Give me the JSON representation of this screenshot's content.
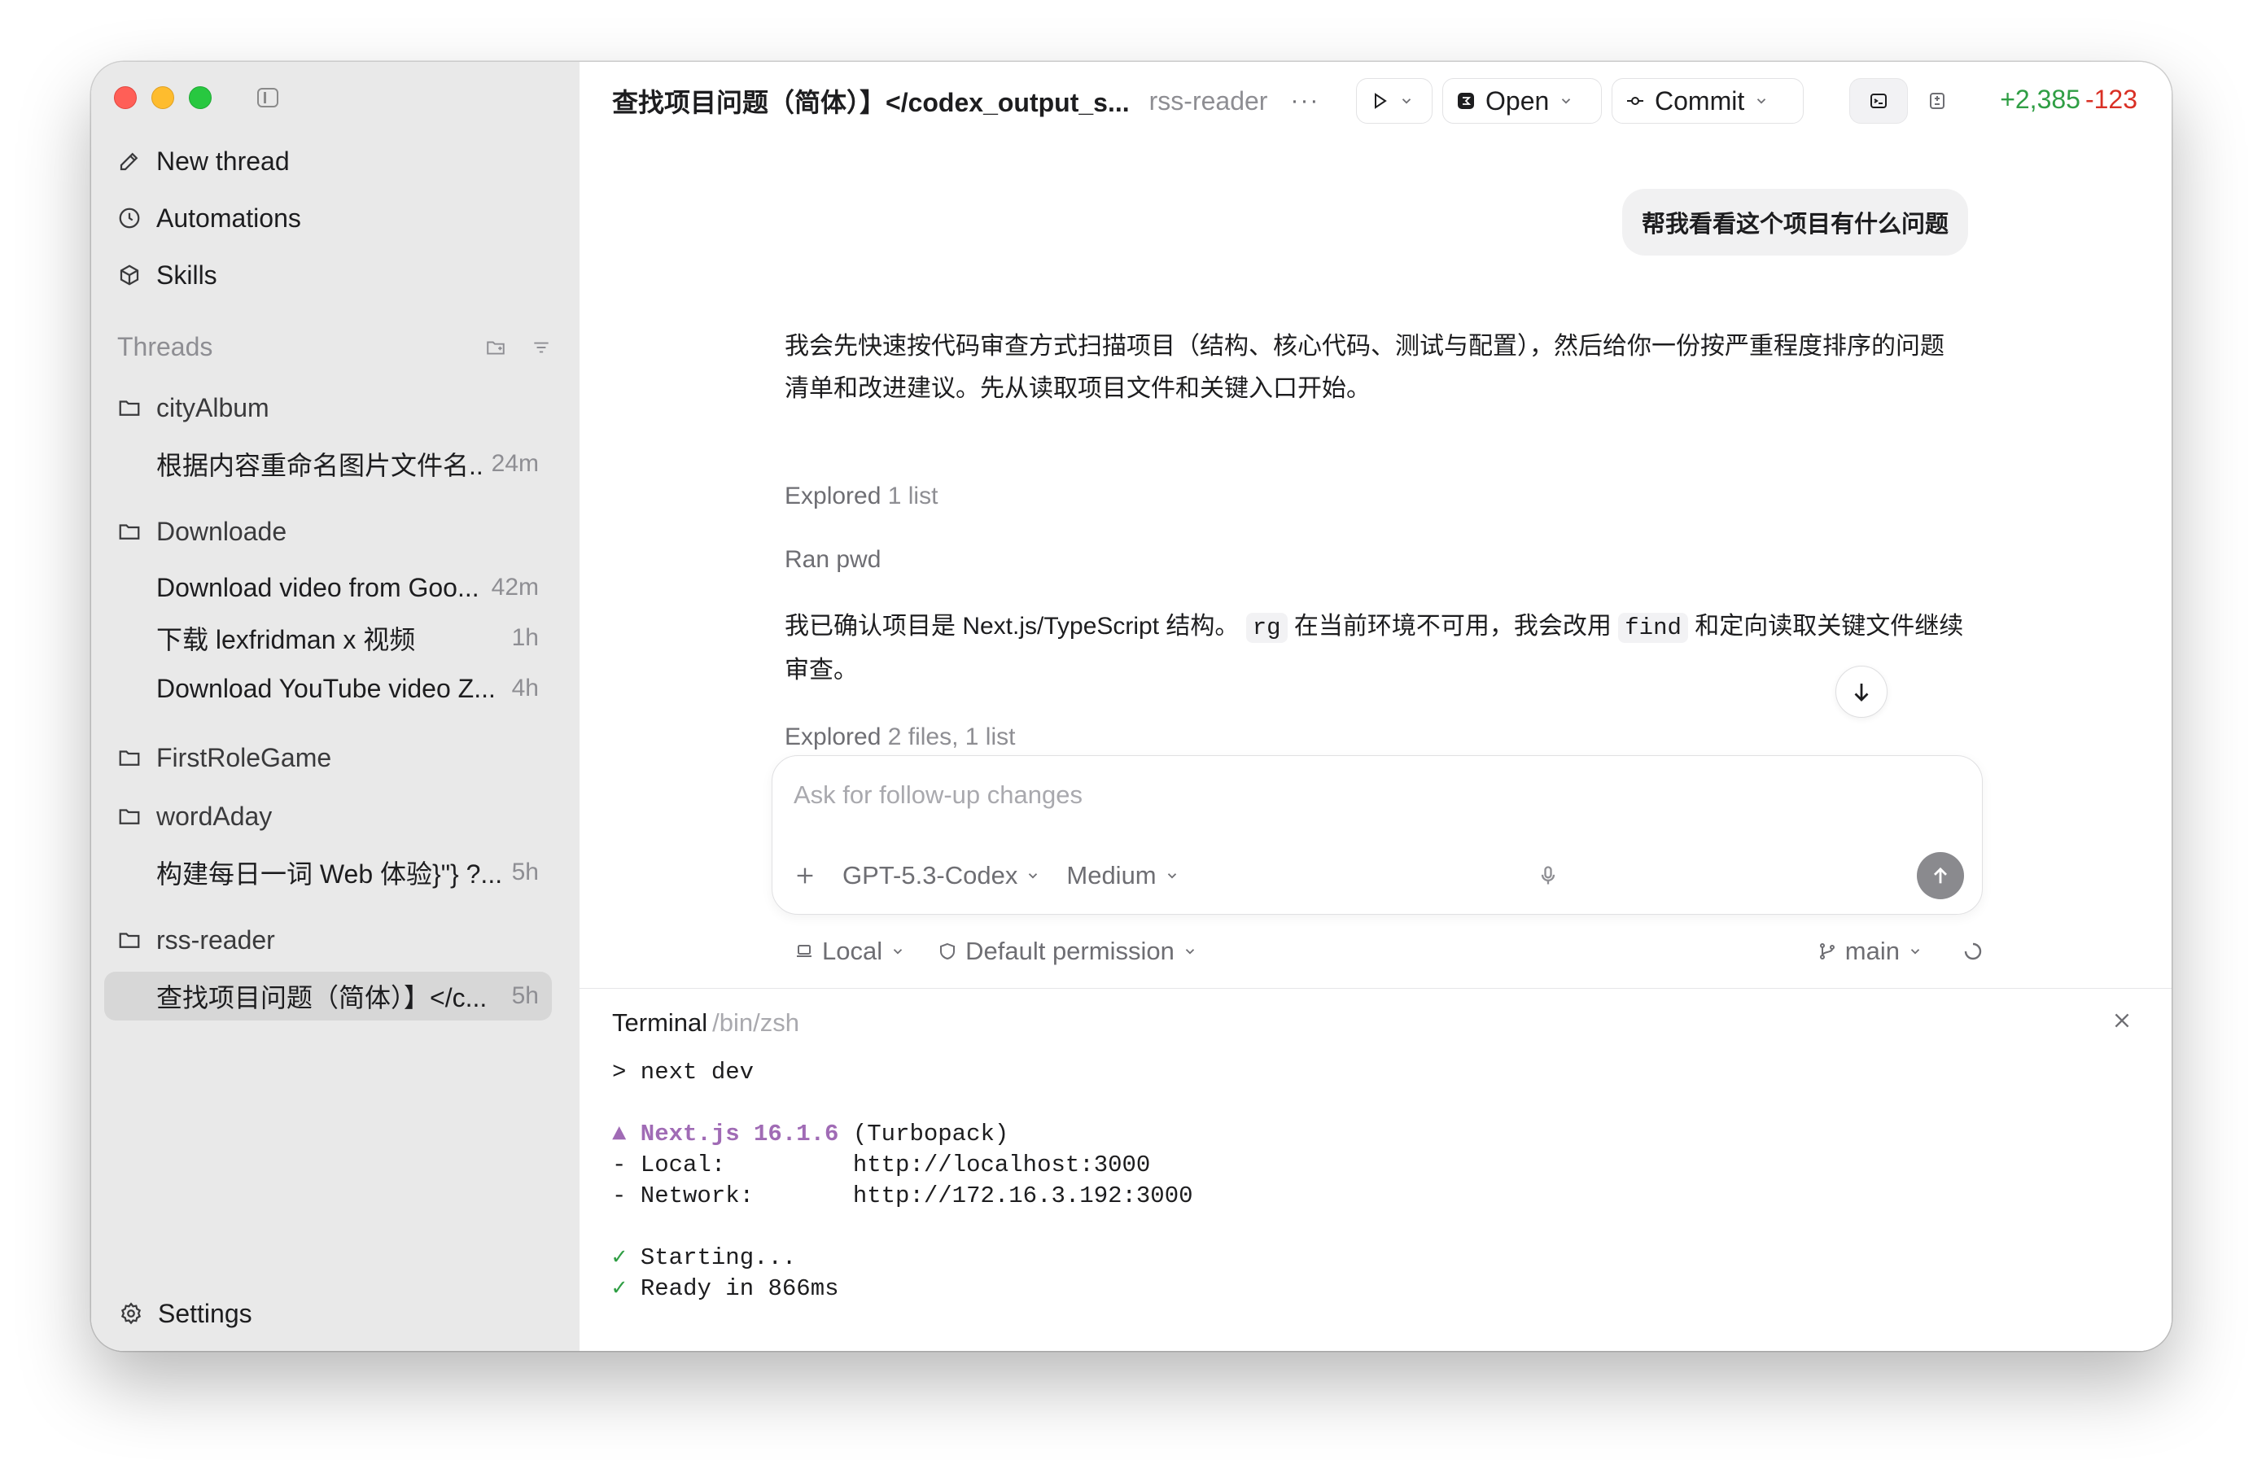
{
  "sidebar": {
    "nav": [
      {
        "label": "New thread",
        "icon": "compose-icon"
      },
      {
        "label": "Automations",
        "icon": "clock-icon"
      },
      {
        "label": "Skills",
        "icon": "cube-icon"
      }
    ],
    "threads_heading": "Threads",
    "projects": [
      {
        "name": "cityAlbum",
        "threads": [
          {
            "title": "根据内容重命名图片文件名...",
            "time": "24m"
          }
        ]
      },
      {
        "name": "Downloade",
        "threads": [
          {
            "title": "Download video from Goo...",
            "time": "42m"
          },
          {
            "title": "下载 lexfridman x 视频",
            "time": "1h"
          },
          {
            "title": "Download YouTube video Z...",
            "time": "4h"
          }
        ]
      },
      {
        "name": "FirstRoleGame",
        "threads": []
      },
      {
        "name": "wordAday",
        "threads": [
          {
            "title": "构建每日一词 Web 体验}\"} ?...",
            "time": "5h"
          }
        ]
      },
      {
        "name": "rss-reader",
        "threads": [
          {
            "title": "查找项目问题（简体）】</c...",
            "time": "5h",
            "active": true
          }
        ]
      }
    ],
    "settings_label": "Settings"
  },
  "topbar": {
    "title": "查找项目问题（简体）】</codex_output_s...",
    "project": "rss-reader",
    "more": "···",
    "open_label": "Open",
    "commit_label": "Commit",
    "additions": "+2,385",
    "deletions": "-123"
  },
  "conversation": {
    "user_message": "帮我看看这个项目有什么问题",
    "assistant_intro": "我会先快速按代码审查方式扫描项目（结构、核心代码、测试与配置），然后给你一份按严重程度排序的问题清单和改进建议。先从读取项目文件和关键入口开始。",
    "explored1": {
      "verb": "Explored",
      "detail": "1 list"
    },
    "ran": "Ran pwd",
    "confirm": {
      "part1": "我已确认项目是 Next.js/TypeScript 结构。",
      "code1": "rg",
      "part2": "在当前环境不可用，我会改用",
      "code2": "find",
      "part3": "和定向读取关键文件继续审查。"
    },
    "explored2": {
      "verb": "Explored",
      "detail": "2 files, 1 list"
    }
  },
  "composer": {
    "placeholder": "Ask for follow-up changes",
    "model": "GPT-5.3-Codex",
    "effort": "Medium",
    "location": "Local",
    "permission": "Default permission",
    "branch": "main"
  },
  "terminal": {
    "title": "Terminal",
    "path": "/bin/zsh",
    "command": "> next dev",
    "next_label": "▲ Next.js 16.1.6",
    "next_suffix": " (Turbopack)",
    "local_line": "- Local:         http://localhost:3000",
    "network_line": "- Network:       http://172.16.3.192:3000",
    "check": "✓",
    "starting": " Starting...",
    "ready": " Ready in 866ms"
  }
}
